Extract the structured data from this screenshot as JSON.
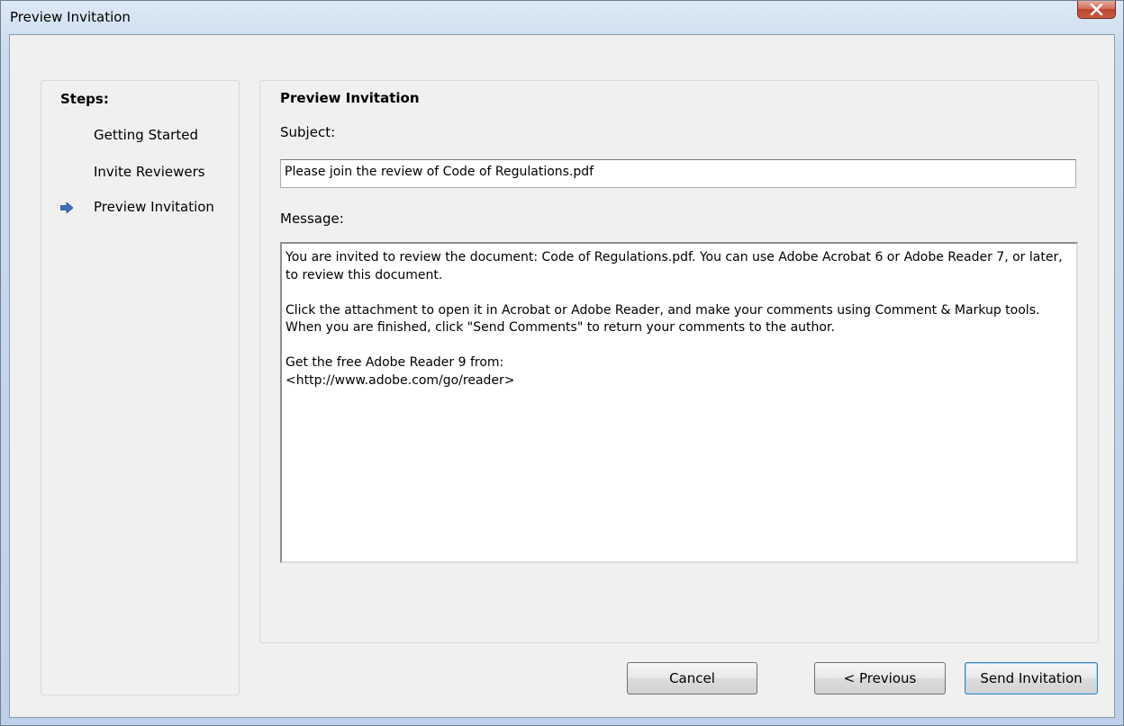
{
  "window": {
    "title": "Preview Invitation"
  },
  "steps": {
    "heading": "Steps:",
    "items": [
      {
        "label": "Getting Started",
        "current": false
      },
      {
        "label": "Invite Reviewers",
        "current": false
      },
      {
        "label": "Preview Invitation",
        "current": true
      }
    ]
  },
  "main": {
    "heading": "Preview Invitation",
    "subject_label": "Subject:",
    "subject_value": "Please join the review of Code of Regulations.pdf",
    "message_label": "Message:",
    "message_value": "You are invited to review the document: Code of Regulations.pdf. You can use Adobe Acrobat 6 or Adobe Reader 7, or later, to review this document.\n\nClick the attachment to open it in Acrobat or Adobe Reader, and make your comments using Comment & Markup tools. When you are finished, click \"Send Comments\" to return your comments to the author.\n\nGet the free Adobe Reader 9 from:\n<http://www.adobe.com/go/reader>"
  },
  "buttons": {
    "cancel": "Cancel",
    "previous": "< Previous",
    "send": "Send Invitation"
  },
  "colors": {
    "arrow": "#3f6fb8",
    "close_button": "#c8503a"
  }
}
